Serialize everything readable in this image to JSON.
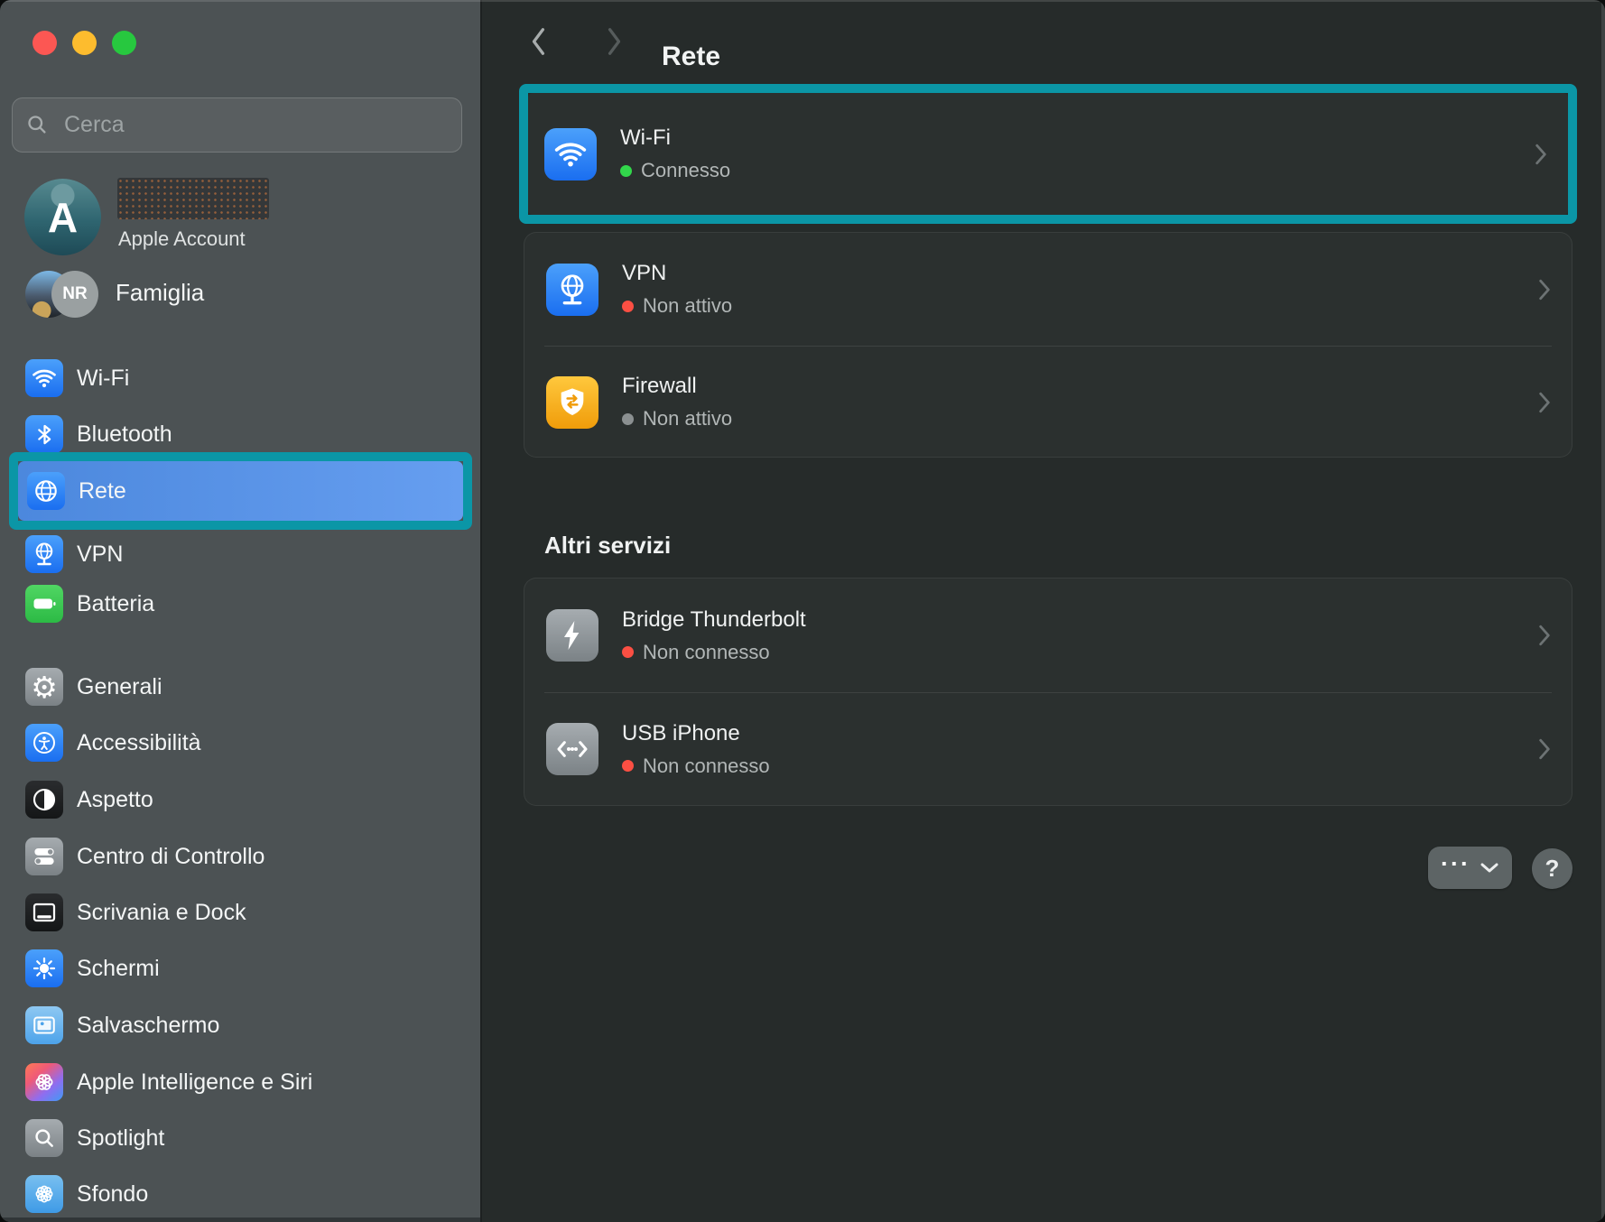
{
  "annotations": {
    "highlight_color": "#0b96a6"
  },
  "chrome": {
    "traffic_lights": [
      "close",
      "minimize",
      "zoom"
    ]
  },
  "sidebar": {
    "search": {
      "placeholder": "Cerca"
    },
    "account": {
      "initial": "A",
      "subtitle": "Apple Account",
      "name_redacted": true
    },
    "family": {
      "label": "Famiglia",
      "badge": "NR"
    },
    "groups": [
      {
        "items": [
          {
            "label": "Wi-Fi",
            "icon": "wifi-icon"
          },
          {
            "label": "Bluetooth",
            "icon": "bluetooth-icon"
          },
          {
            "label": "Rete",
            "icon": "globe-icon",
            "selected": true
          },
          {
            "label": "VPN",
            "icon": "vpn-globe-icon"
          },
          {
            "label": "Batteria",
            "icon": "battery-icon"
          }
        ]
      },
      {
        "items": [
          {
            "label": "Generali",
            "icon": "gear-icon"
          },
          {
            "label": "Accessibilità",
            "icon": "accessibility-icon"
          },
          {
            "label": "Aspetto",
            "icon": "contrast-icon"
          },
          {
            "label": "Centro di Controllo",
            "icon": "toggles-icon"
          },
          {
            "label": "Scrivania e Dock",
            "icon": "desktop-dock-icon"
          },
          {
            "label": "Schermi",
            "icon": "sun-icon"
          },
          {
            "label": "Salvaschermo",
            "icon": "screensaver-icon"
          },
          {
            "label": "Apple Intelligence e Siri",
            "icon": "ai-flower-icon"
          },
          {
            "label": "Spotlight",
            "icon": "magnifier-icon"
          },
          {
            "label": "Sfondo",
            "icon": "flower-icon"
          }
        ]
      }
    ]
  },
  "header": {
    "title": "Rete"
  },
  "main": {
    "wifi_row": {
      "label": "Wi-Fi",
      "status": "Connesso",
      "status_color": "#32d74b"
    },
    "network_rows": [
      {
        "label": "VPN",
        "status": "Non attivo",
        "status_color": "#fb4f43"
      },
      {
        "label": "Firewall",
        "status": "Non attivo",
        "status_color": "#8b9091"
      }
    ],
    "section_heading": "Altri servizi",
    "services": [
      {
        "label": "Bridge Thunderbolt",
        "status": "Non connesso",
        "status_color": "#fb4f43"
      },
      {
        "label": "USB iPhone",
        "status": "Non connesso",
        "status_color": "#fb4f43"
      }
    ],
    "footer": {
      "more_label": "···",
      "help_label": "?"
    }
  }
}
